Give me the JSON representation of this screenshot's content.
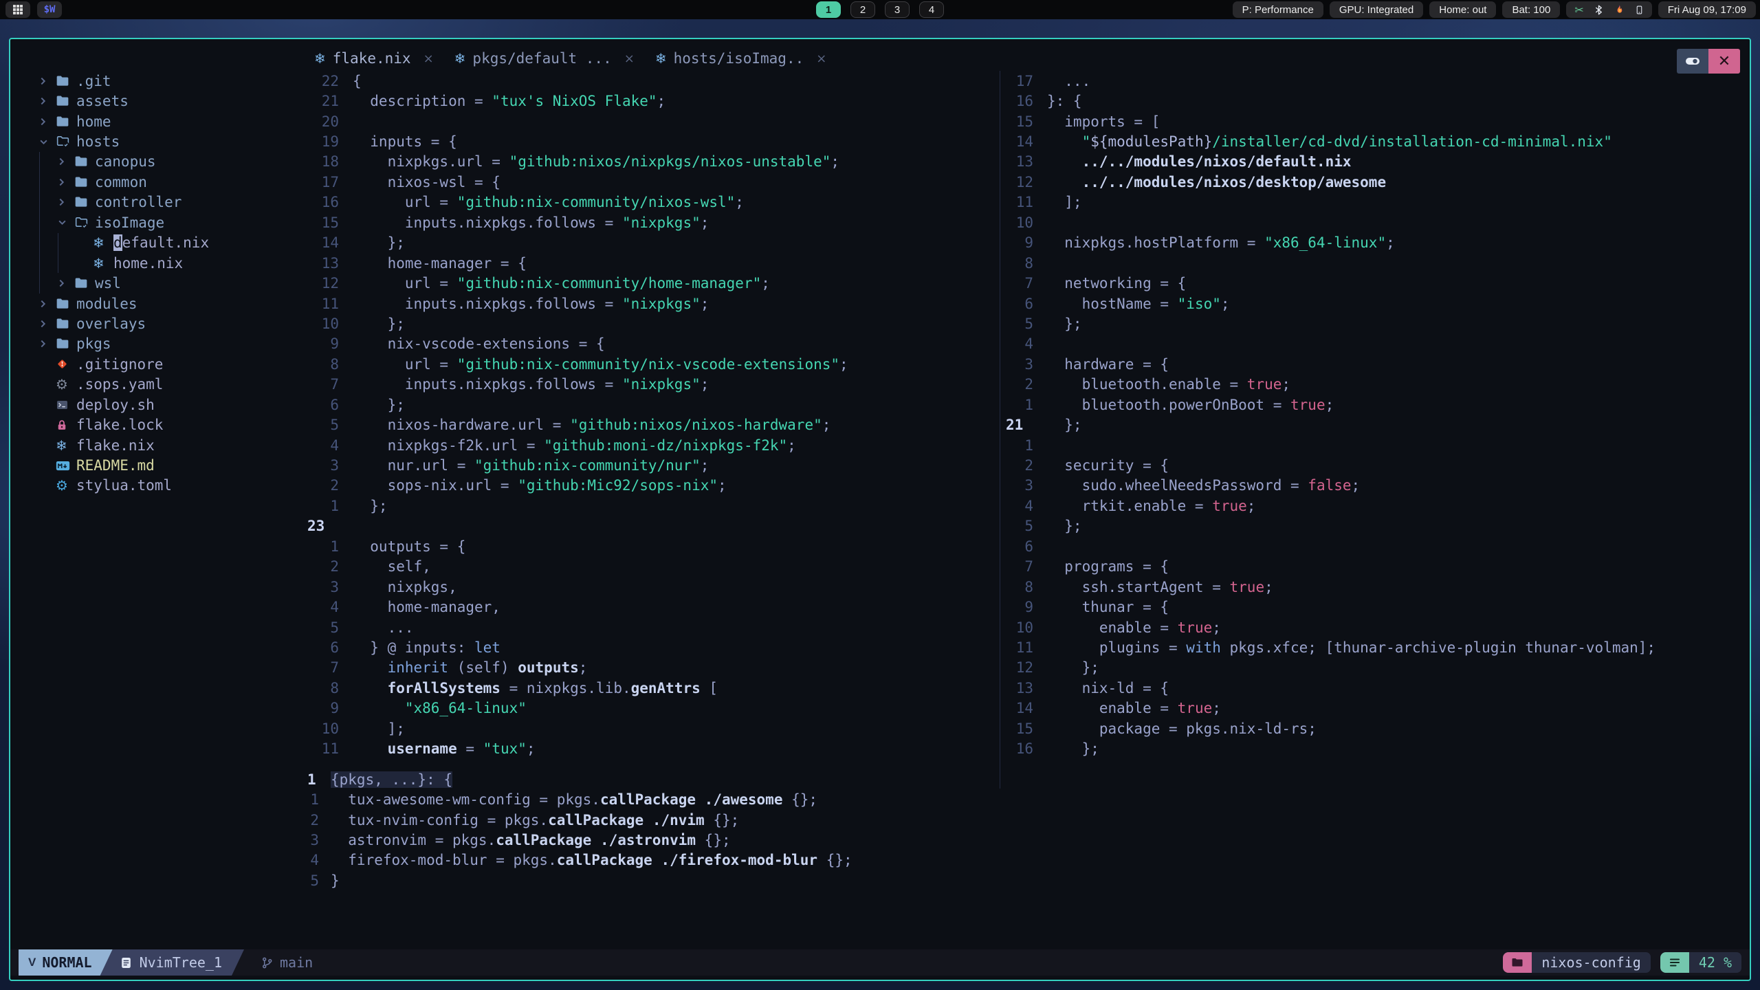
{
  "topbar": {
    "logo": "$W",
    "workspaces": [
      "1",
      "2",
      "3",
      "4"
    ],
    "active_workspace": "1",
    "status_pills": [
      "P: Performance",
      "GPU: Integrated",
      "Home: out",
      "Bat: 100"
    ],
    "clock": "Fri Aug 09, 17:09"
  },
  "window": {
    "accent_color": "#35cfc0",
    "tabs": [
      {
        "label": "flake.nix",
        "icon": "nix-icon",
        "close": "×",
        "active": true
      },
      {
        "label": "pkgs/default ...",
        "icon": "nix-icon",
        "close": "×",
        "active": false
      },
      {
        "label": "hosts/isoImag..",
        "icon": "nix-icon",
        "close": "×",
        "active": false
      }
    ]
  },
  "sidebar": {
    "items": [
      {
        "label": ".git",
        "icon": "folder",
        "chevron": "right",
        "level": 0,
        "cls": ""
      },
      {
        "label": "assets",
        "icon": "folder",
        "chevron": "right",
        "level": 0,
        "cls": ""
      },
      {
        "label": "home",
        "icon": "folder",
        "chevron": "right",
        "level": 0,
        "cls": ""
      },
      {
        "label": "hosts",
        "icon": "folder-open-check",
        "chevron": "down",
        "level": 0,
        "cls": ""
      },
      {
        "label": "canopus",
        "icon": "folder",
        "chevron": "right",
        "level": 1,
        "cls": ""
      },
      {
        "label": "common",
        "icon": "folder",
        "chevron": "right",
        "level": 1,
        "cls": ""
      },
      {
        "label": "controller",
        "icon": "folder",
        "chevron": "right",
        "level": 1,
        "cls": ""
      },
      {
        "label": "isoImage",
        "icon": "folder-open-check",
        "chevron": "down",
        "level": 1,
        "cls": ""
      },
      {
        "label": "default.nix",
        "icon": "nix",
        "chevron": "",
        "level": 2,
        "cls": "file",
        "cursor": true
      },
      {
        "label": "home.nix",
        "icon": "nix",
        "chevron": "",
        "level": 2,
        "cls": "file"
      },
      {
        "label": "wsl",
        "icon": "folder",
        "chevron": "right",
        "level": 1,
        "cls": ""
      },
      {
        "label": "modules",
        "icon": "folder",
        "chevron": "right",
        "level": 0,
        "cls": ""
      },
      {
        "label": "overlays",
        "icon": "folder",
        "chevron": "right",
        "level": 0,
        "cls": ""
      },
      {
        "label": "pkgs",
        "icon": "folder",
        "chevron": "right",
        "level": 0,
        "cls": ""
      },
      {
        "label": ".gitignore",
        "icon": "git",
        "chevron": "",
        "level": 0,
        "cls": "file"
      },
      {
        "label": ".sops.yaml",
        "icon": "gear-gray",
        "chevron": "",
        "level": 0,
        "cls": "file"
      },
      {
        "label": "deploy.sh",
        "icon": "terminal",
        "chevron": "",
        "level": 0,
        "cls": "file"
      },
      {
        "label": "flake.lock",
        "icon": "lock",
        "chevron": "",
        "level": 0,
        "cls": "file"
      },
      {
        "label": "flake.nix",
        "icon": "nix",
        "chevron": "",
        "level": 0,
        "cls": "file"
      },
      {
        "label": "README.md",
        "icon": "markdown",
        "chevron": "",
        "level": 0,
        "cls": "readme"
      },
      {
        "label": "stylua.toml",
        "icon": "gear-blue",
        "chevron": "",
        "level": 0,
        "cls": "file"
      }
    ]
  },
  "editor": {
    "left": [
      {
        "n": "22",
        "t": "{"
      },
      {
        "n": "21",
        "t": "  description = \"tux's NixOS Flake\";"
      },
      {
        "n": "20",
        "t": ""
      },
      {
        "n": "19",
        "t": "  inputs = {"
      },
      {
        "n": "18",
        "t": "    nixpkgs.url = \"github:nixos/nixpkgs/nixos-unstable\";"
      },
      {
        "n": "17",
        "t": "    nixos-wsl = {"
      },
      {
        "n": "16",
        "t": "      url = \"github:nix-community/nixos-wsl\";"
      },
      {
        "n": "15",
        "t": "      inputs.nixpkgs.follows = \"nixpkgs\";"
      },
      {
        "n": "14",
        "t": "    };"
      },
      {
        "n": "13",
        "t": "    home-manager = {"
      },
      {
        "n": "12",
        "t": "      url = \"github:nix-community/home-manager\";"
      },
      {
        "n": "11",
        "t": "      inputs.nixpkgs.follows = \"nixpkgs\";"
      },
      {
        "n": "10",
        "t": "    };"
      },
      {
        "n": "9",
        "t": "    nix-vscode-extensions = {"
      },
      {
        "n": "8",
        "t": "      url = \"github:nix-community/nix-vscode-extensions\";"
      },
      {
        "n": "7",
        "t": "      inputs.nixpkgs.follows = \"nixpkgs\";"
      },
      {
        "n": "6",
        "t": "    };"
      },
      {
        "n": "5",
        "t": "    nixos-hardware.url = \"github:nixos/nixos-hardware\";"
      },
      {
        "n": "4",
        "t": "    nixpkgs-f2k.url = \"github:moni-dz/nixpkgs-f2k\";"
      },
      {
        "n": "3",
        "t": "    nur.url = \"github:nix-community/nur\";"
      },
      {
        "n": "2",
        "t": "    sops-nix.url = \"github:Mic92/sops-nix\";"
      },
      {
        "n": "1",
        "t": "  };"
      },
      {
        "n": "23",
        "t": "",
        "c": true
      },
      {
        "n": "1",
        "t": "  outputs = {"
      },
      {
        "n": "2",
        "t": "    self,"
      },
      {
        "n": "3",
        "t": "    nixpkgs,"
      },
      {
        "n": "4",
        "t": "    home-manager,"
      },
      {
        "n": "5",
        "t": "    ..."
      },
      {
        "n": "6",
        "t": "  } @ inputs: let"
      },
      {
        "n": "7",
        "t": "    inherit (self) outputs;"
      },
      {
        "n": "8",
        "t": "    forAllSystems = nixpkgs.lib.genAttrs ["
      },
      {
        "n": "9",
        "t": "      \"x86_64-linux\""
      },
      {
        "n": "10",
        "t": "    ];"
      },
      {
        "n": "11",
        "t": "    username = \"tux\";"
      }
    ],
    "right": [
      {
        "n": "17",
        "t": "  ..."
      },
      {
        "n": "16",
        "t": "}: {"
      },
      {
        "n": "15",
        "t": "  imports = ["
      },
      {
        "n": "14",
        "t": "    \"${modulesPath}/installer/cd-dvd/installation-cd-minimal.nix\""
      },
      {
        "n": "13",
        "t": "    ../../modules/nixos/default.nix"
      },
      {
        "n": "12",
        "t": "    ../../modules/nixos/desktop/awesome"
      },
      {
        "n": "11",
        "t": "  ];"
      },
      {
        "n": "10",
        "t": ""
      },
      {
        "n": "9",
        "t": "  nixpkgs.hostPlatform = \"x86_64-linux\";"
      },
      {
        "n": "8",
        "t": ""
      },
      {
        "n": "7",
        "t": "  networking = {"
      },
      {
        "n": "6",
        "t": "    hostName = \"iso\";"
      },
      {
        "n": "5",
        "t": "  };"
      },
      {
        "n": "4",
        "t": ""
      },
      {
        "n": "3",
        "t": "  hardware = {"
      },
      {
        "n": "2",
        "t": "    bluetooth.enable = true;"
      },
      {
        "n": "1",
        "t": "    bluetooth.powerOnBoot = true;"
      },
      {
        "n": "21",
        "t": "  };",
        "c": true
      },
      {
        "n": "1",
        "t": ""
      },
      {
        "n": "2",
        "t": "  security = {"
      },
      {
        "n": "3",
        "t": "    sudo.wheelNeedsPassword = false;"
      },
      {
        "n": "4",
        "t": "    rtkit.enable = true;"
      },
      {
        "n": "5",
        "t": "  };"
      },
      {
        "n": "6",
        "t": ""
      },
      {
        "n": "7",
        "t": "  programs = {"
      },
      {
        "n": "8",
        "t": "    ssh.startAgent = true;"
      },
      {
        "n": "9",
        "t": "    thunar = {"
      },
      {
        "n": "10",
        "t": "      enable = true;"
      },
      {
        "n": "11",
        "t": "      plugins = with pkgs.xfce; [thunar-archive-plugin thunar-volman];"
      },
      {
        "n": "12",
        "t": "    };"
      },
      {
        "n": "13",
        "t": "    nix-ld = {"
      },
      {
        "n": "14",
        "t": "      enable = true;"
      },
      {
        "n": "15",
        "t": "      package = pkgs.nix-ld-rs;"
      },
      {
        "n": "16",
        "t": "    };"
      }
    ],
    "bottom": [
      {
        "n": "1",
        "t": "{pkgs, ...}: {",
        "c": true,
        "h": true
      },
      {
        "n": "1",
        "t": "  tux-awesome-wm-config = pkgs.callPackage ./awesome {};"
      },
      {
        "n": "2",
        "t": "  tux-nvim-config = pkgs.callPackage ./nvim {};"
      },
      {
        "n": "3",
        "t": "  astronvim = pkgs.callPackage ./astronvim {};"
      },
      {
        "n": "4",
        "t": "  firefox-mod-blur = pkgs.callPackage ./firefox-mod-blur {};"
      },
      {
        "n": "5",
        "t": "}"
      }
    ]
  },
  "statusbar": {
    "mode": "NORMAL",
    "buffer": "NvimTree_1",
    "branch": "main",
    "project": "nixos-config",
    "scroll": "42 %"
  }
}
